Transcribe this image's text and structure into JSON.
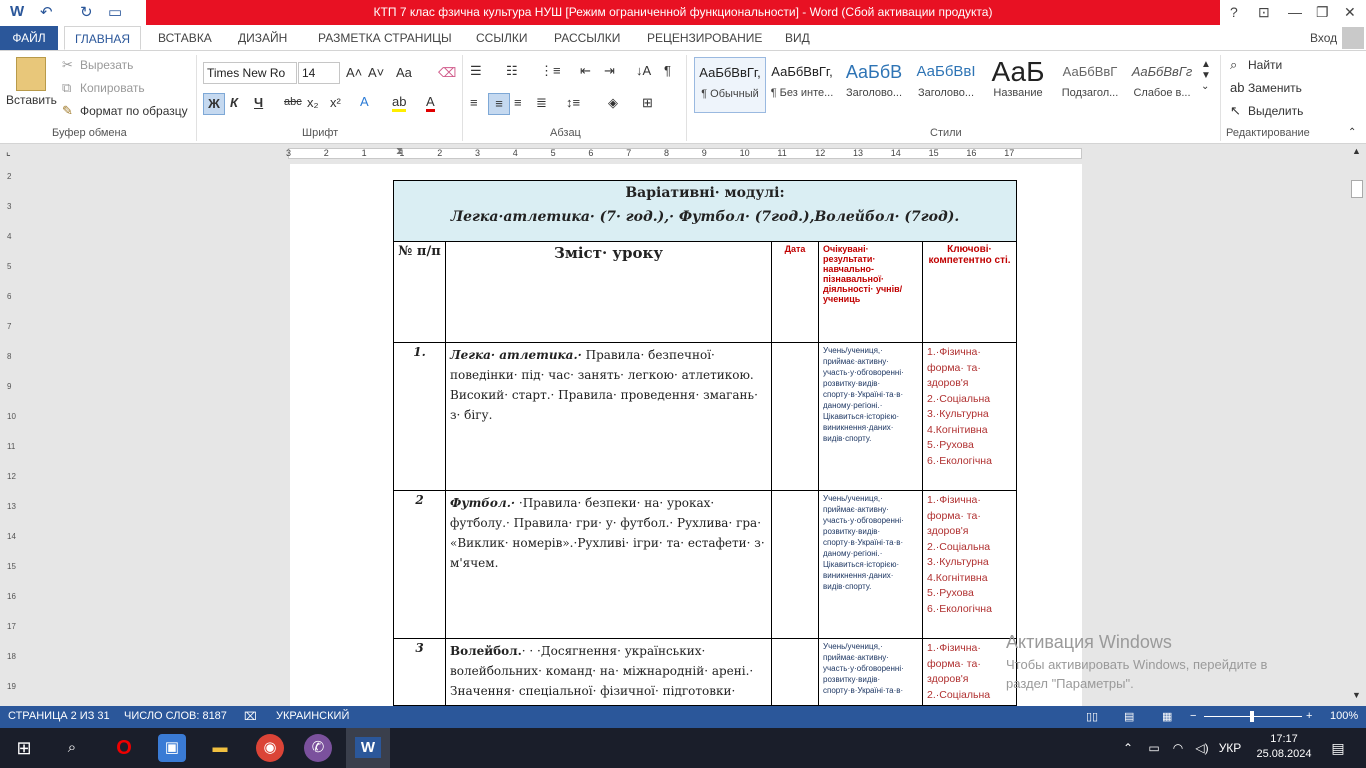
{
  "titlebar": {
    "title": "КТП 7 клас фзична культура НУШ [Режим ограниченной функциональности] -  Word (Сбой активации продукта)",
    "help": "?",
    "login": "Вход"
  },
  "tabs": {
    "file": "ФАЙЛ",
    "items": [
      "ГЛАВНАЯ",
      "ВСТАВКА",
      "ДИЗАЙН",
      "РАЗМЕТКА СТРАНИЦЫ",
      "ССЫЛКИ",
      "РАССЫЛКИ",
      "РЕЦЕНЗИРОВАНИЕ",
      "ВИД"
    ]
  },
  "ribbon": {
    "clipboard": {
      "paste": "Вставить",
      "cut": "Вырезать",
      "copy": "Копировать",
      "format": "Формат по образцу",
      "label": "Буфер обмена"
    },
    "font": {
      "name": "Times New Ro",
      "size": "14",
      "label": "Шрифт",
      "bold": "Ж",
      "italic": "К",
      "underline": "Ч",
      "strike": "abc",
      "sub": "x₂",
      "sup": "x²"
    },
    "paragraph": {
      "label": "Абзац"
    },
    "styles": {
      "label": "Стили",
      "items": [
        {
          "preview": "АаБбВвГг,",
          "name": "¶ Обычный"
        },
        {
          "preview": "АаБбВвГг,",
          "name": "¶ Без инте..."
        },
        {
          "preview": "АаБбВ",
          "name": "Заголово..."
        },
        {
          "preview": "АаБбВвІ",
          "name": "Заголово..."
        },
        {
          "preview": "АаБ",
          "name": "Название"
        },
        {
          "preview": "АаБбВвГ",
          "name": "Подзагол..."
        },
        {
          "preview": "АаБбВвГг",
          "name": "Слабое в..."
        }
      ]
    },
    "editing": {
      "find": "Найти",
      "replace": "Заменить",
      "select": "Выделить",
      "label": "Редактирование"
    }
  },
  "ruler": {
    "ticks": [
      "3",
      "2",
      "1",
      "1",
      "2",
      "3",
      "4",
      "5",
      "6",
      "7",
      "8",
      "9",
      "10",
      "11",
      "12",
      "13",
      "14",
      "15",
      "16",
      "17"
    ]
  },
  "vruler": {
    "ticks": [
      "2",
      "3",
      "4",
      "5",
      "6",
      "7",
      "8",
      "9",
      "10",
      "11",
      "12",
      "13",
      "14",
      "15",
      "16",
      "17",
      "18",
      "19"
    ]
  },
  "document": {
    "header_line1": "Варіативні· модулі:",
    "header_line2": "Легка·атлетика· (7· год.),· Футбол· (7год.),Волейбол· (7год).",
    "col_num": "№ п/п",
    "col_content": "Зміст· уроку",
    "col_date": "Дата",
    "col_expected": "Очікувані· результати· навчально-пізнавальної· діяльності· учнів/учениць",
    "col_key": "Ключові· компетентно сті.",
    "rows": [
      {
        "num": "1.",
        "title": "Легка· атлетика.·",
        "text": " Правила· безпечної· поведінки· під· час· занять· легкою· атлетикою.",
        "text2": "Високий· старт.· Правила· проведення· змагань· з· бігу.",
        "expected": "Учень/учениця,· приймає·активну· участь·у·обговоренні· розвитку·видів· спорту·в·Україні·та·в· даному·регіоні.· Цікавиться·історією· виникнення·даних· видів·спорту.",
        "key": [
          "1.·Фізична· форма· та· здоров'я",
          "2.·Соціальна",
          "3.·Культурна",
          "4.Когнітивна",
          "5.·Рухова",
          "6.·Екологічна"
        ]
      },
      {
        "num": "2",
        "title": "Футбол.·",
        "text": " ·Правила· безпеки· на· уроках· футболу.· Правила· гри· у· футбол.· Рухлива· гра· «Виклик· номерів».·Рухливі· ігри· та· естафети· з· м'ячем.",
        "expected": "Учень/учениця,· приймає·активну· участь·у·обговоренні· розвитку·видів· спорту·в·Україні·та·в· даному·регіоні.· Цікавиться·історією· виникнення·даних· видів·спорту.",
        "key": [
          "1.·Фізична· форма· та· здоров'я",
          "2.·Соціальна",
          "3.·Культурна",
          "4.Когнітивна",
          "5.·Рухова",
          "6.·Екологічна"
        ]
      },
      {
        "num": "3",
        "title": "Волейбол.",
        "text": "· · ·Досягнення· українських· волейбольних· команд· на· міжнародній· арені.· Значення· спеціальної· фізичної· підготовки·",
        "expected": "Учень/учениця,· приймає·активну· участь·у·обговоренні· розвитку·видів· спорту·в·Україні·та·в·",
        "key": [
          "1.·Фізична· форма· та· здоров'я",
          "2.·Соціальна"
        ]
      }
    ]
  },
  "activation": {
    "title": "Активация Windows",
    "line1": "Чтобы активировать Windows, перейдите в",
    "line2": "раздел \"Параметры\"."
  },
  "status": {
    "page": "СТРАНИЦА 2 ИЗ 31",
    "words": "ЧИСЛО СЛОВ: 8187",
    "lang": "УКРАИНСКИЙ",
    "zoom": "100%"
  },
  "taskbar": {
    "lang": "УКР",
    "time": "17:17",
    "date": "25.08.2024"
  }
}
